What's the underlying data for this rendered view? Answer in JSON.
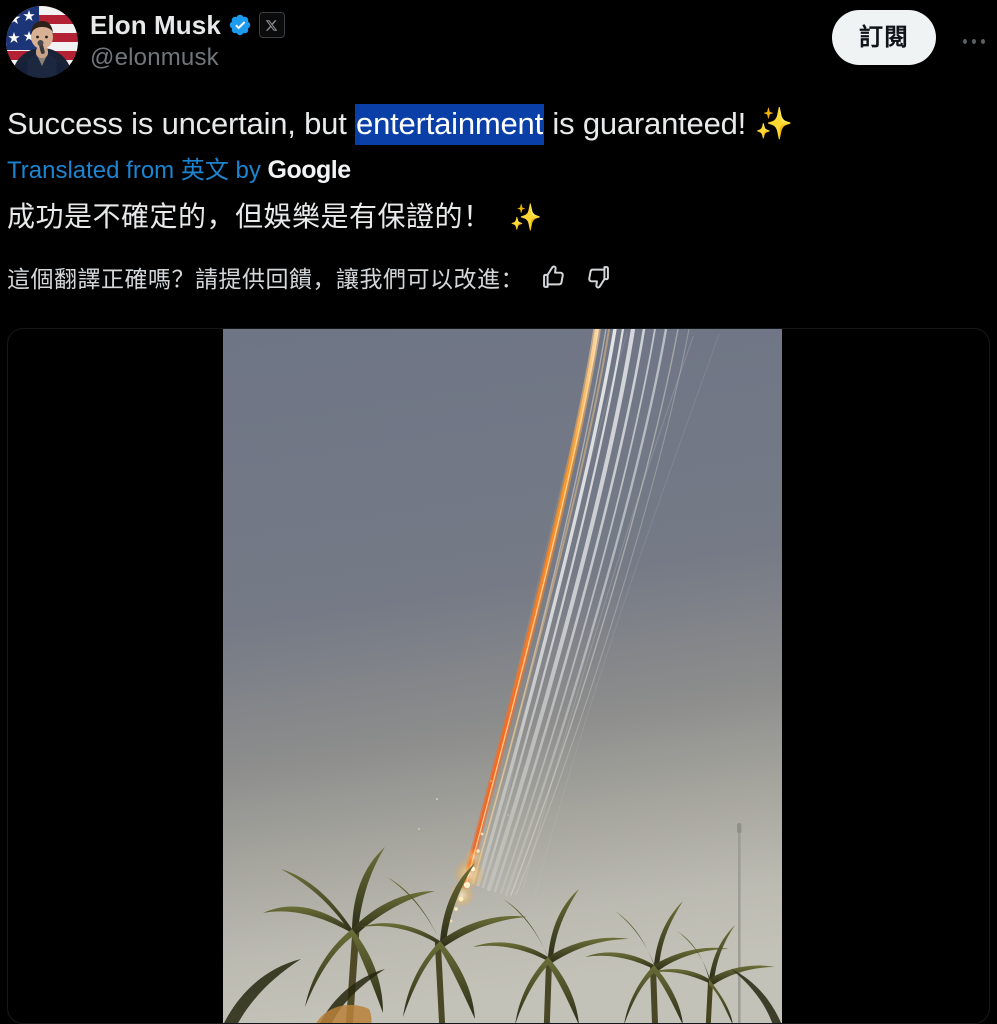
{
  "post": {
    "author": {
      "display_name": "Elon Musk",
      "handle": "@elonmusk",
      "verified_badge": "verified-check-icon",
      "affiliation_badge": "x-logo-icon",
      "avatar": "elon-musk-avatar-us-flag"
    },
    "actions": {
      "subscribe_label": "訂閱",
      "more_options": "more-options-icon"
    },
    "text": {
      "before_selection": "Success is uncertain, but ",
      "selected": "entertainment",
      "after_selection": " is guaranteed! ",
      "emoji": "✨"
    },
    "translation": {
      "prefix": "Translated from ",
      "source_language": "英文",
      "by": " by ",
      "provider": "Google",
      "translated_text": "成功是不確定的，但娛樂是有保證的！",
      "emoji": "✨",
      "feedback_prompt": "這個翻譯正確嗎？請提供回饋，讓我們可以改進：",
      "thumbs_up": "thumbs-up-icon",
      "thumbs_down": "thumbs-down-icon"
    },
    "media": {
      "type": "video",
      "description": "rocket-reentry-streaks-over-palm-trees"
    }
  },
  "colors": {
    "background": "#000000",
    "text_primary": "#e7e9ea",
    "text_secondary": "#71767b",
    "link_blue": "#1d84d0",
    "selection_blue": "#0b3fa8",
    "verified_blue": "#1d9bf0",
    "button_bg": "#eff3f4",
    "button_text": "#0f1419",
    "emoji_amber": "#f5a623"
  }
}
